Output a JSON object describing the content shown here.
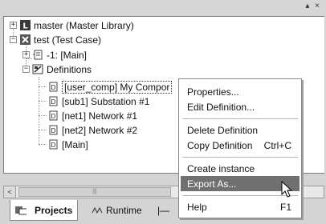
{
  "titlebar": {
    "buttons": "▴ ×"
  },
  "tree": {
    "items": [
      {
        "label": "master (Master Library)",
        "expander": "+",
        "icon": "master-library-icon"
      },
      {
        "label": "test (Test Case)",
        "expander": "−",
        "icon": "test-case-icon"
      },
      {
        "label": "-1: [Main]",
        "expander": "+",
        "icon": "main-module-icon"
      },
      {
        "label": "Definitions",
        "expander": "−",
        "icon": "definitions-icon"
      },
      {
        "label": "[user_comp] My Compor",
        "icon": "component-definition-icon"
      },
      {
        "label": "[sub1] Substation #1",
        "icon": "component-definition-icon"
      },
      {
        "label": "[net1] Network #1",
        "icon": "component-definition-icon"
      },
      {
        "label": "[net2] Network #2",
        "icon": "component-definition-icon"
      },
      {
        "label": "[Main]",
        "icon": "component-definition-icon"
      }
    ]
  },
  "scrollbar": {
    "left_arrow": "<",
    "thumb_grip": "|||"
  },
  "tabs": [
    {
      "label": "Projects",
      "icon": "projects-icon",
      "active": true
    },
    {
      "label": "Runtime",
      "icon": "runtime-icon",
      "active": false
    },
    {
      "label": "|—",
      "icon": "wire-icon",
      "active": false
    }
  ],
  "context_menu": {
    "items": [
      {
        "label": "Properties...",
        "shortcut": ""
      },
      {
        "label": "Edit Definition...",
        "shortcut": ""
      },
      {
        "label": "Delete Definition",
        "shortcut": ""
      },
      {
        "label": "Copy Definition",
        "shortcut": "Ctrl+C"
      },
      {
        "label": "Create instance",
        "shortcut": ""
      },
      {
        "label": "Export As...",
        "shortcut": "",
        "highlighted": true
      },
      {
        "label": "Help",
        "shortcut": "F1"
      }
    ]
  },
  "colors": {
    "highlight": "#707070",
    "panel_bg": "#ffffff",
    "chrome_bg": "#d4d4d4"
  }
}
